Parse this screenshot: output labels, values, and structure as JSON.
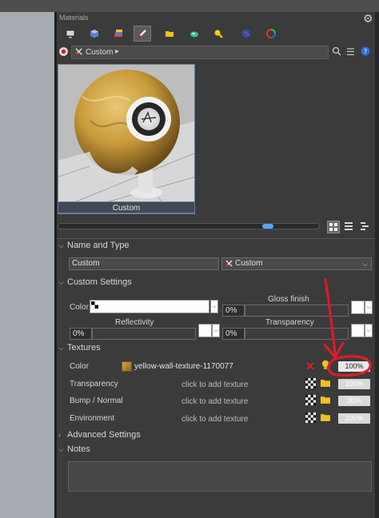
{
  "panel": {
    "title": "Materials"
  },
  "icons": {
    "settings": "gear-icon",
    "categories": [
      "display-icon",
      "cube-icon",
      "layers-icon",
      "paint-icon",
      "folder-icon",
      "terrain-icon",
      "light-icon",
      "globe-icon",
      "color-wheel-icon"
    ]
  },
  "path": {
    "label": "Custom",
    "arrow": "▸"
  },
  "preview": {
    "label": "Custom"
  },
  "name_type": {
    "header": "Name and Type",
    "name_value": "Custom",
    "type_value": "Custom"
  },
  "custom_settings": {
    "header": "Custom Settings",
    "color_label": "Color:",
    "gloss_label": "Gloss finish",
    "gloss_value": "0%",
    "reflectivity_label": "Reflectivity",
    "reflectivity_value": "0%",
    "transparency_label": "Transparency",
    "transparency_value": "0%"
  },
  "textures": {
    "header": "Textures",
    "rows": [
      {
        "label": "Color",
        "value": "yellow-wall-texture-1170077",
        "percent": "100%"
      },
      {
        "label": "Transparency",
        "value": "click to add texture",
        "percent": "100%"
      },
      {
        "label": "Bump / Normal",
        "value": "click to add texture",
        "percent": "30%"
      },
      {
        "label": "Environment",
        "value": "click to add texture",
        "percent": "100%"
      }
    ]
  },
  "advanced": {
    "header": "Advanced Settings"
  },
  "notes": {
    "header": "Notes"
  },
  "annotation_color": "#e0192b",
  "accent_color": "#5aa3f0"
}
